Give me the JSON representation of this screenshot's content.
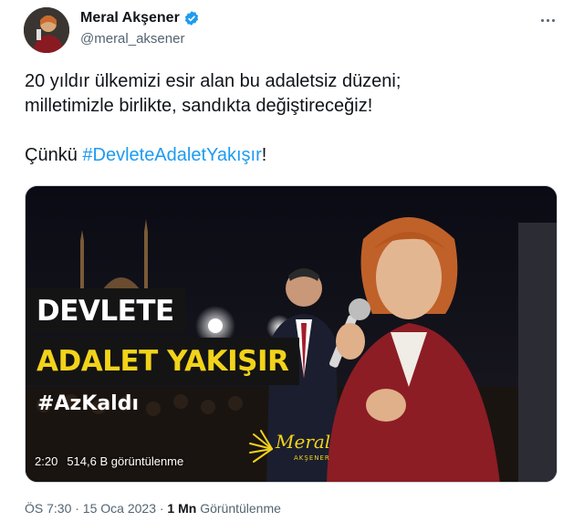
{
  "user": {
    "name": "Meral Akşener",
    "handle": "@meral_aksener",
    "verified_icon": "verified-badge-icon",
    "more_icon": "more-options-icon"
  },
  "tweet": {
    "line1": "20 yıldır ülkemizi esir alan bu adaletsiz düzeni;",
    "line2": "milletimizle birlikte, sandıkta değiştireceğiz!",
    "line3_prefix": "Çünkü ",
    "hashtag": "#DevleteAdaletYakışır",
    "line3_suffix": "!"
  },
  "media": {
    "banner_line1": "DEVLETE",
    "banner_line2": "ADALET YAKIŞIR",
    "overlay_hashtag": "#AzKaldı",
    "signature_name": "Meral",
    "signature_sub": "AKŞENER",
    "duration": "2:20",
    "views": "514,6 B görüntülenme"
  },
  "footer": {
    "time_date": "ÖS 7:30 · 15 Oca 2023 · ",
    "view_count": "1 Mn",
    "view_label": " Görüntülenme"
  },
  "colors": {
    "accent": "#1d9bf0",
    "banner_yellow": "#f2d31a",
    "secondary_text": "#536471"
  }
}
